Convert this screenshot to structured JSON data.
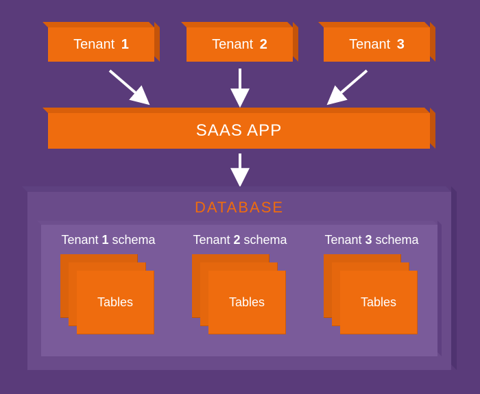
{
  "tenants": [
    {
      "prefix": "Tenant",
      "num": "1"
    },
    {
      "prefix": "Tenant",
      "num": "2"
    },
    {
      "prefix": "Tenant",
      "num": "3"
    }
  ],
  "saas_label": "SAAS APP",
  "database": {
    "title": "DATABASE",
    "schemas": [
      {
        "prefix": "Tenant",
        "num": "1",
        "suffix": "schema",
        "tables": "Tables"
      },
      {
        "prefix": "Tenant",
        "num": "2",
        "suffix": "schema",
        "tables": "Tables"
      },
      {
        "prefix": "Tenant",
        "num": "3",
        "suffix": "schema",
        "tables": "Tables"
      }
    ]
  },
  "colors": {
    "bg": "#5a3b7a",
    "orange": "#ef6c0e",
    "db": "#6a4b8a",
    "db_inner": "#7a5b9a"
  }
}
